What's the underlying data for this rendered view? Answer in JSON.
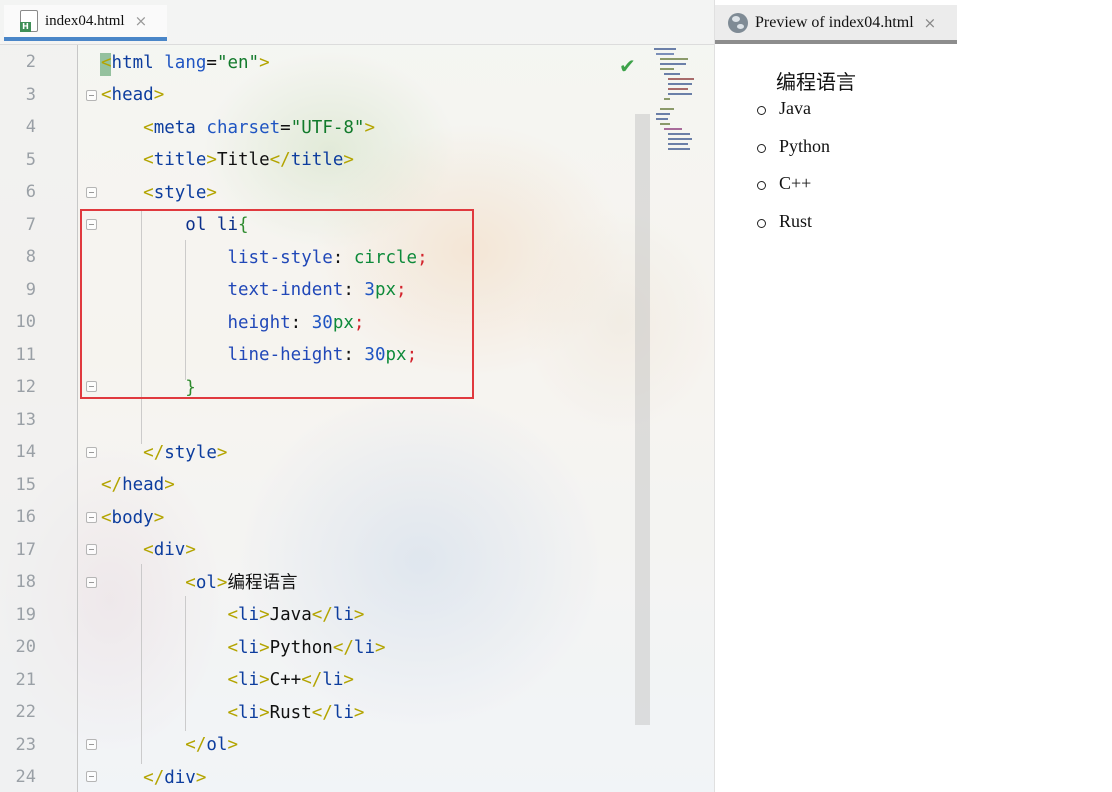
{
  "editor": {
    "tab": {
      "label": "index04.html",
      "close": "×",
      "icon_letter": "H"
    },
    "line_numbers": [
      "2",
      "3",
      "4",
      "5",
      "6",
      "7",
      "8",
      "9",
      "10",
      "11",
      "12",
      "13",
      "14",
      "15",
      "16",
      "17",
      "18",
      "19",
      "20",
      "21",
      "22",
      "23",
      "24"
    ],
    "code_lines": [
      "<html lang=\"en\">",
      "<head>",
      "    <meta charset=\"UTF-8\">",
      "    <title>Title</title>",
      "    <style>",
      "        ol li{",
      "            list-style: circle;",
      "            text-indent: 3px;",
      "            height: 30px;",
      "            line-height: 30px;",
      "        }",
      "",
      "    </style>",
      "</head>",
      "<body>",
      "    <div>",
      "        <ol>编程语言",
      "            <li>Java</li>",
      "            <li>Python</li>",
      "            <li>C++</li>",
      "            <li>Rust</li>",
      "        </ol>",
      "    </div>"
    ],
    "status_icon": "checkmark-icon"
  },
  "preview": {
    "tab": {
      "label": "Preview of index04.html",
      "close": "×"
    },
    "heading": "编程语言",
    "items": [
      "Java",
      "Python",
      "C++",
      "Rust"
    ]
  },
  "colors": {
    "highlight_box": "#e0393e",
    "tab_active_underline": "#4a86c8",
    "checkmark": "#3da24a"
  }
}
